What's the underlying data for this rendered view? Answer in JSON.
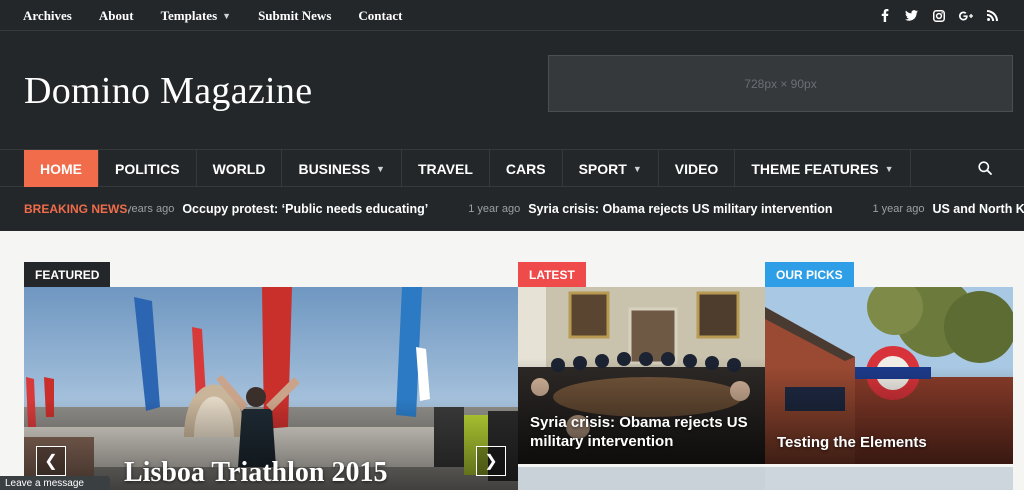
{
  "topnav": {
    "items": [
      {
        "label": "Archives"
      },
      {
        "label": "About"
      },
      {
        "label": "Templates"
      },
      {
        "label": "Submit News"
      },
      {
        "label": "Contact"
      }
    ],
    "social_icons": [
      "facebook-icon",
      "twitter-icon",
      "instagram-icon",
      "google-plus-icon",
      "rss-icon"
    ]
  },
  "header": {
    "site_title": "Domino Magazine",
    "ad_placeholder": "728px × 90px"
  },
  "mainnav": {
    "items": [
      {
        "label": "HOME"
      },
      {
        "label": "POLITICS"
      },
      {
        "label": "WORLD"
      },
      {
        "label": "BUSINESS"
      },
      {
        "label": "TRAVEL"
      },
      {
        "label": "CARS"
      },
      {
        "label": "SPORT"
      },
      {
        "label": "VIDEO"
      },
      {
        "label": "THEME FEATURES"
      }
    ],
    "active": "HOME"
  },
  "breaking": {
    "label": "BREAKING NEWS",
    "items": [
      {
        "time": "years ago",
        "headline": "Occupy protest: ‘Public needs educating’"
      },
      {
        "time": "1 year ago",
        "headline": "Syria crisis: Obama rejects US military intervention"
      },
      {
        "time": "1 year ago",
        "headline": "US and North Korea to"
      }
    ]
  },
  "sections": {
    "featured": {
      "tag": "FEATURED",
      "title": "Lisboa Triathlon 2015"
    },
    "latest": {
      "tag": "LATEST",
      "title": "Syria crisis: Obama rejects US military intervention"
    },
    "picks": {
      "tag": "OUR PICKS",
      "title": "Testing the Elements"
    }
  },
  "chat": {
    "label": "Leave a message"
  },
  "colors": {
    "dark": "#23272a",
    "accent": "#f06c4a",
    "latest": "#f04b4b",
    "picks": "#2e9fe6"
  }
}
